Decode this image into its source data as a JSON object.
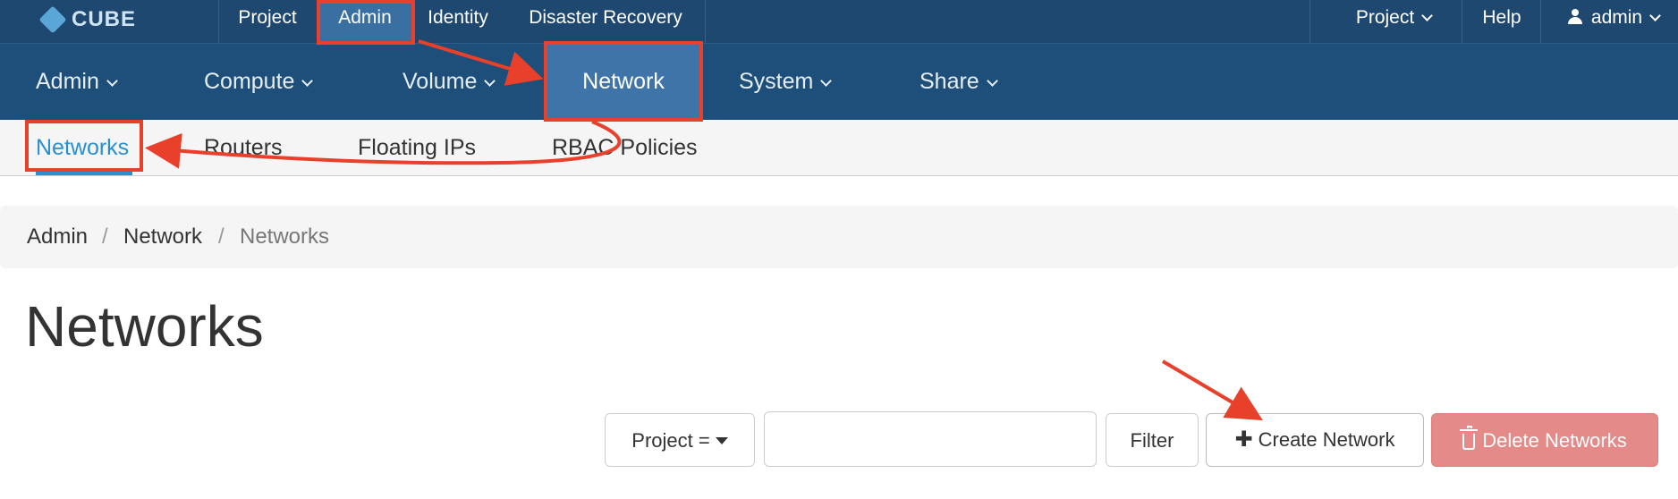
{
  "brand": {
    "logo_text": "CUBE"
  },
  "topbar": {
    "items": [
      "Project",
      "Admin",
      "Identity",
      "Disaster Recovery"
    ],
    "right": {
      "project": "Project",
      "help": "Help",
      "user": "admin"
    }
  },
  "nav2": {
    "items": [
      "Admin",
      "Compute",
      "Volume",
      "Network",
      "System",
      "Share"
    ],
    "active": "Network"
  },
  "subnav": {
    "items": [
      "Networks",
      "Routers",
      "Floating IPs",
      "RBAC Policies"
    ],
    "active": "Networks"
  },
  "breadcrumb": {
    "items": [
      "Admin",
      "Network",
      "Networks"
    ],
    "separator": "/"
  },
  "page_title": "Networks",
  "toolbar": {
    "filter_select": "Project =",
    "search_value": "",
    "filter_label": "Filter",
    "create_label": "Create Network",
    "delete_label": "Delete Networks"
  },
  "colors": {
    "topbar": "#1f4870",
    "navbar": "#1e4e7a",
    "active": "#3f74a8",
    "accent": "#2a8fd0",
    "annotation": "#e8402a",
    "danger": "#e48a88"
  }
}
